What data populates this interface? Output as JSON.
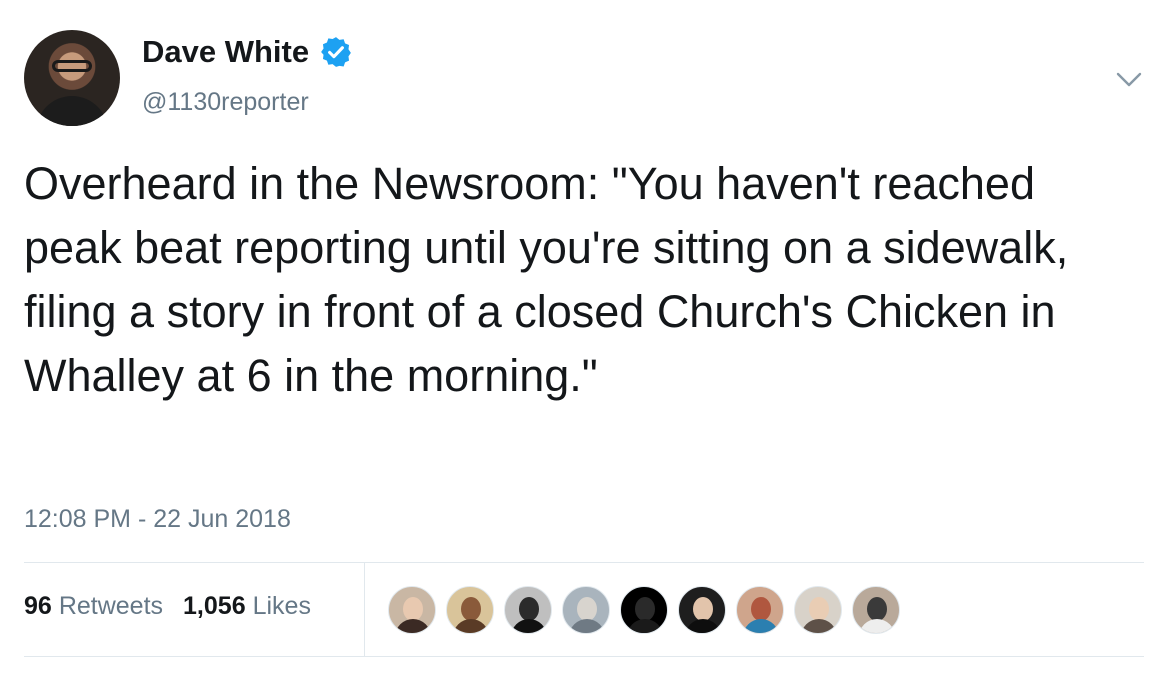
{
  "tweet": {
    "author": {
      "display_name": "Dave White",
      "handle": "@1130reporter",
      "verified": true,
      "avatar_icon": "profile-photo"
    },
    "text": "Overheard in the Newsroom: \"You haven't reached peak beat reporting until you're sitting on a sidewalk, filing a story in front of a closed Church's Chicken in Whalley at 6 in the morning.\"",
    "timestamp": "12:08 PM - 22 Jun 2018",
    "stats": {
      "retweets_count": "96",
      "retweets_label": "Retweets",
      "likes_count": "1,056",
      "likes_label": "Likes"
    },
    "likers_count": 9,
    "colors": {
      "text": "#14171a",
      "secondary": "#657786",
      "verified": "#1da1f2",
      "divider": "#e1e8ed"
    }
  }
}
